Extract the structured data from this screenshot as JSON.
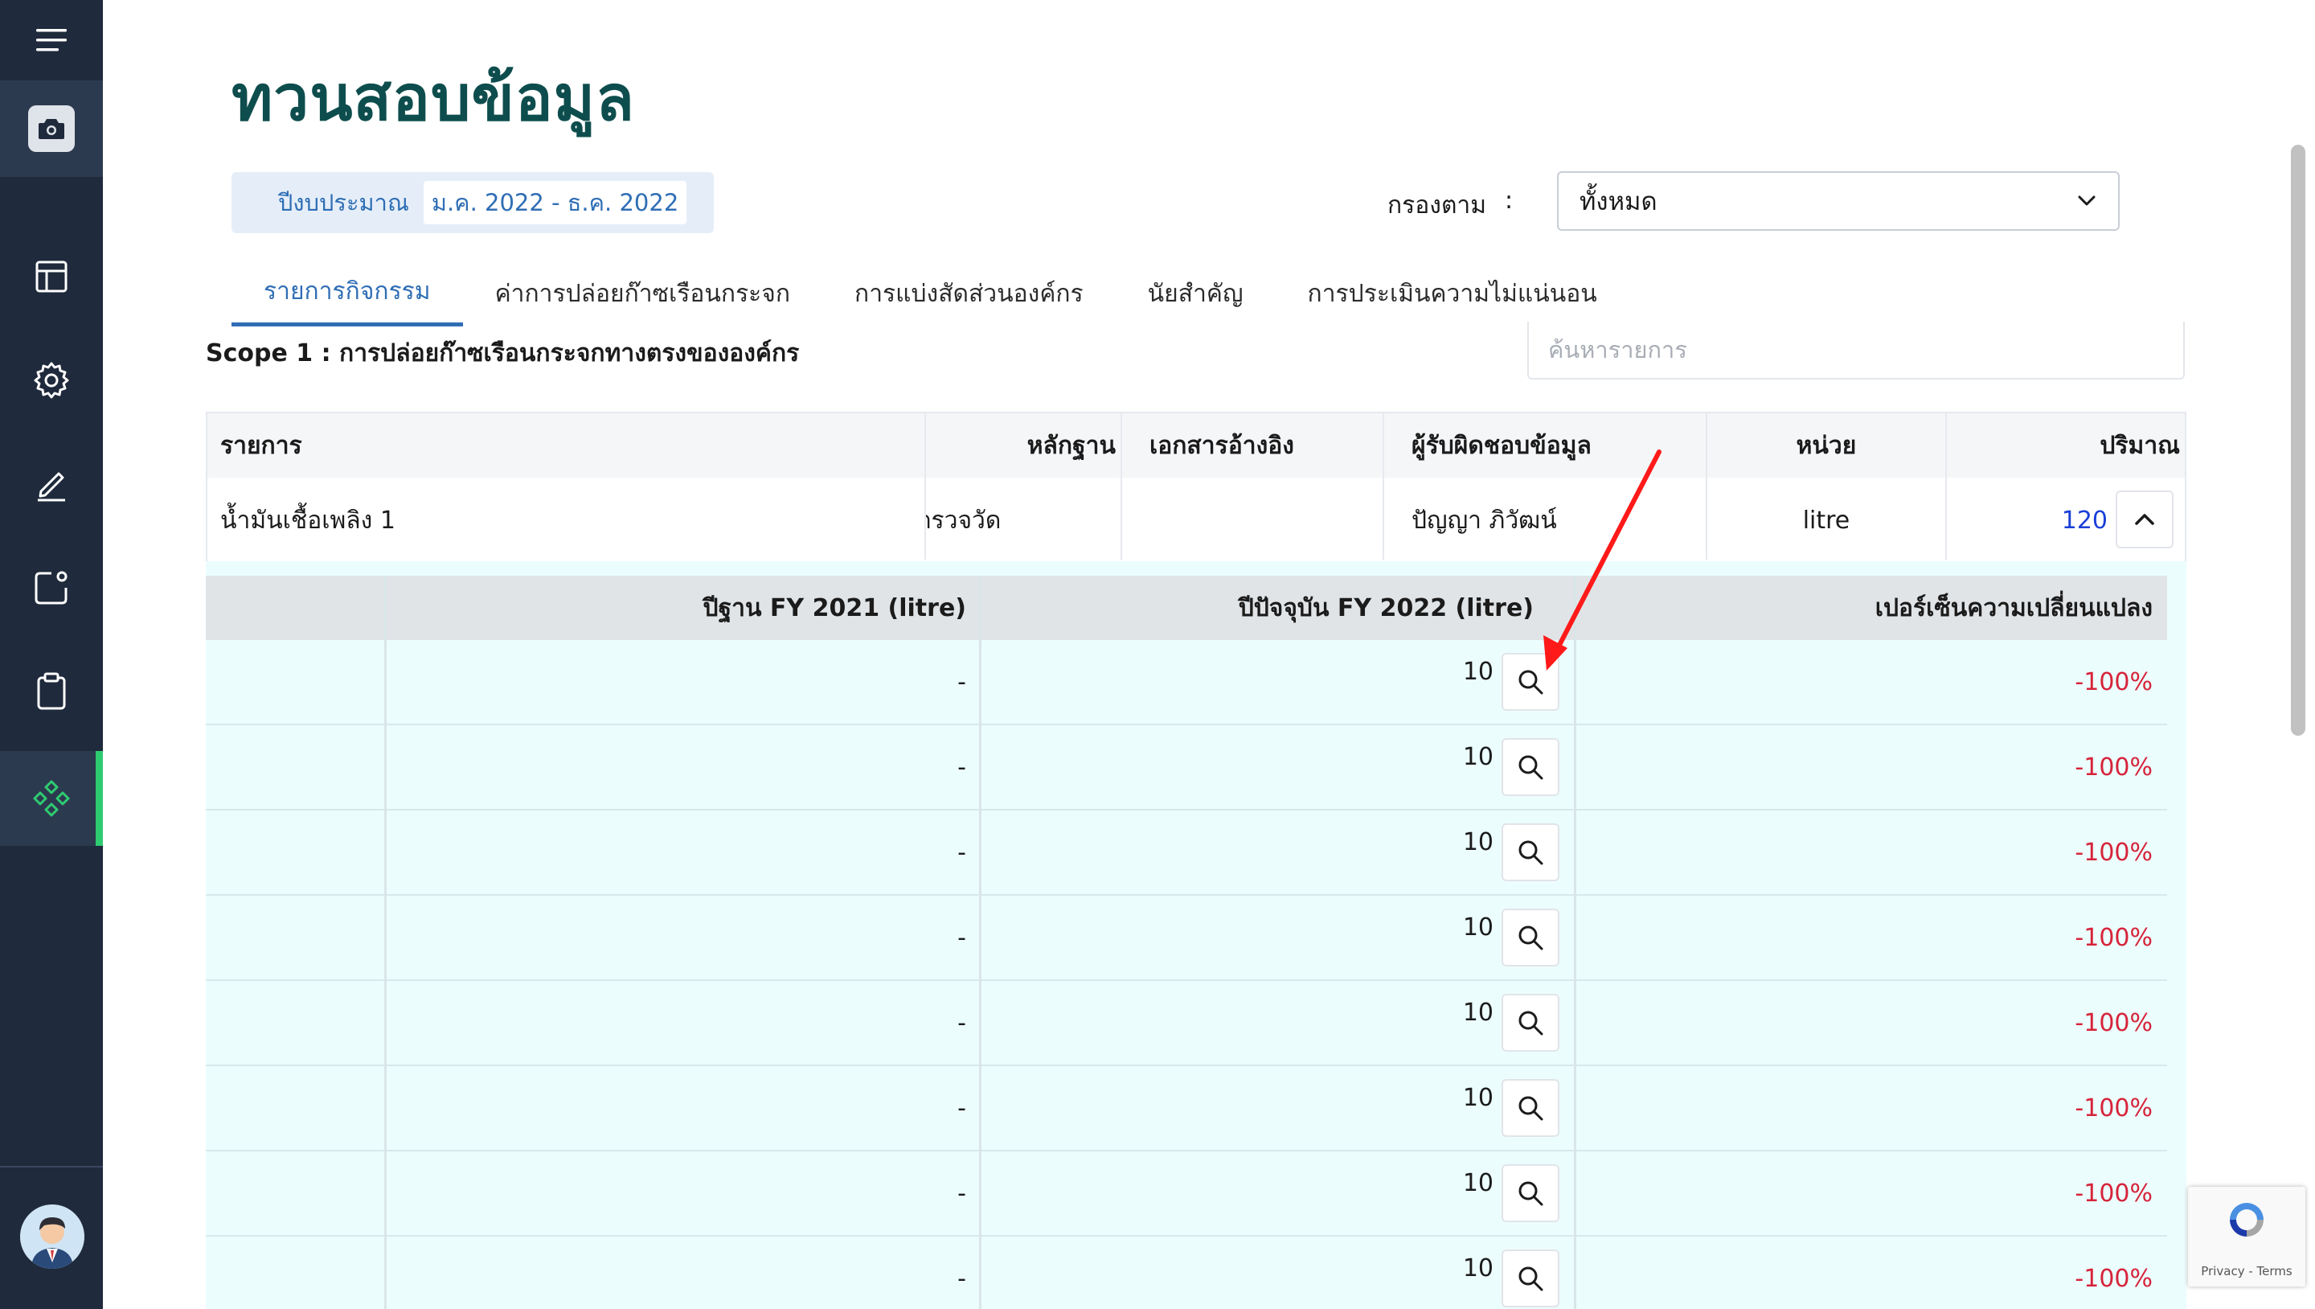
{
  "page": {
    "title": "ทวนสอบข้อมูล"
  },
  "fiscal_year": {
    "label": "ปีงบประมาณ",
    "value": "ม.ค. 2022 - ธ.ค. 2022"
  },
  "filter": {
    "label": "กรองตาม",
    "colon": ":",
    "selected": "ทั้งหมด"
  },
  "tabs": [
    {
      "label": "รายการกิจกรรม",
      "active": true
    },
    {
      "label": "ค่าการปล่อยก๊าซเรือนกระจก",
      "active": false
    },
    {
      "label": "การแบ่งสัดส่วนองค์กร",
      "active": false
    },
    {
      "label": "นัยสำคัญ",
      "active": false
    },
    {
      "label": "การประเมินความไม่แน่นอน",
      "active": false
    }
  ],
  "scope_title": "Scope 1 : การปล่อยก๊าซเรือนกระจกทางตรงขององค์กร",
  "search": {
    "placeholder": "ค้นหารายการ"
  },
  "main_table": {
    "headers": {
      "item": "รายการ",
      "evidence": "หลักฐาน",
      "reference": "เอกสารอ้างอิง",
      "owner": "ผู้รับผิดชอบข้อมูล",
      "unit": "หน่วย",
      "quantity": "ปริมาณ"
    },
    "row": {
      "item": "น้ำมันเชื้อเพลิง 1",
      "evidence": "ตรวจวัด",
      "reference": "",
      "owner": "ปัญญา   ภิวัฒน์",
      "unit": "litre",
      "quantity": "120"
    }
  },
  "sub_table": {
    "headers": {
      "base_year": "ปีฐาน FY 2021 (litre)",
      "current_year": "ปีปัจจุบัน FY 2022 (litre)",
      "percent_change": "เปอร์เซ็นความเปลี่ยนแปลง"
    },
    "rows": [
      {
        "base": "-",
        "current": "10",
        "change": "-100%"
      },
      {
        "base": "-",
        "current": "10",
        "change": "-100%"
      },
      {
        "base": "-",
        "current": "10",
        "change": "-100%"
      },
      {
        "base": "-",
        "current": "10",
        "change": "-100%"
      },
      {
        "base": "-",
        "current": "10",
        "change": "-100%"
      },
      {
        "base": "-",
        "current": "10",
        "change": "-100%"
      },
      {
        "base": "-",
        "current": "10",
        "change": "-100%"
      },
      {
        "base": "-",
        "current": "10",
        "change": "-100%"
      }
    ]
  },
  "recaptcha": {
    "links": "Privacy - Terms"
  },
  "colors": {
    "sidebar": "#1f2a3c",
    "accent_blue": "#2f6eb5",
    "title_green": "#0e4d4d",
    "active_green": "#2ecc71",
    "negative_red": "#d6243a",
    "annotation_arrow": "#ff1a1a"
  },
  "icons": {
    "sidebar": [
      "menu-icon",
      "camera-icon",
      "table-layout-icon",
      "gear-icon",
      "edit-icon",
      "notification-icon",
      "clipboard-icon",
      "diamond-grid-icon"
    ]
  }
}
